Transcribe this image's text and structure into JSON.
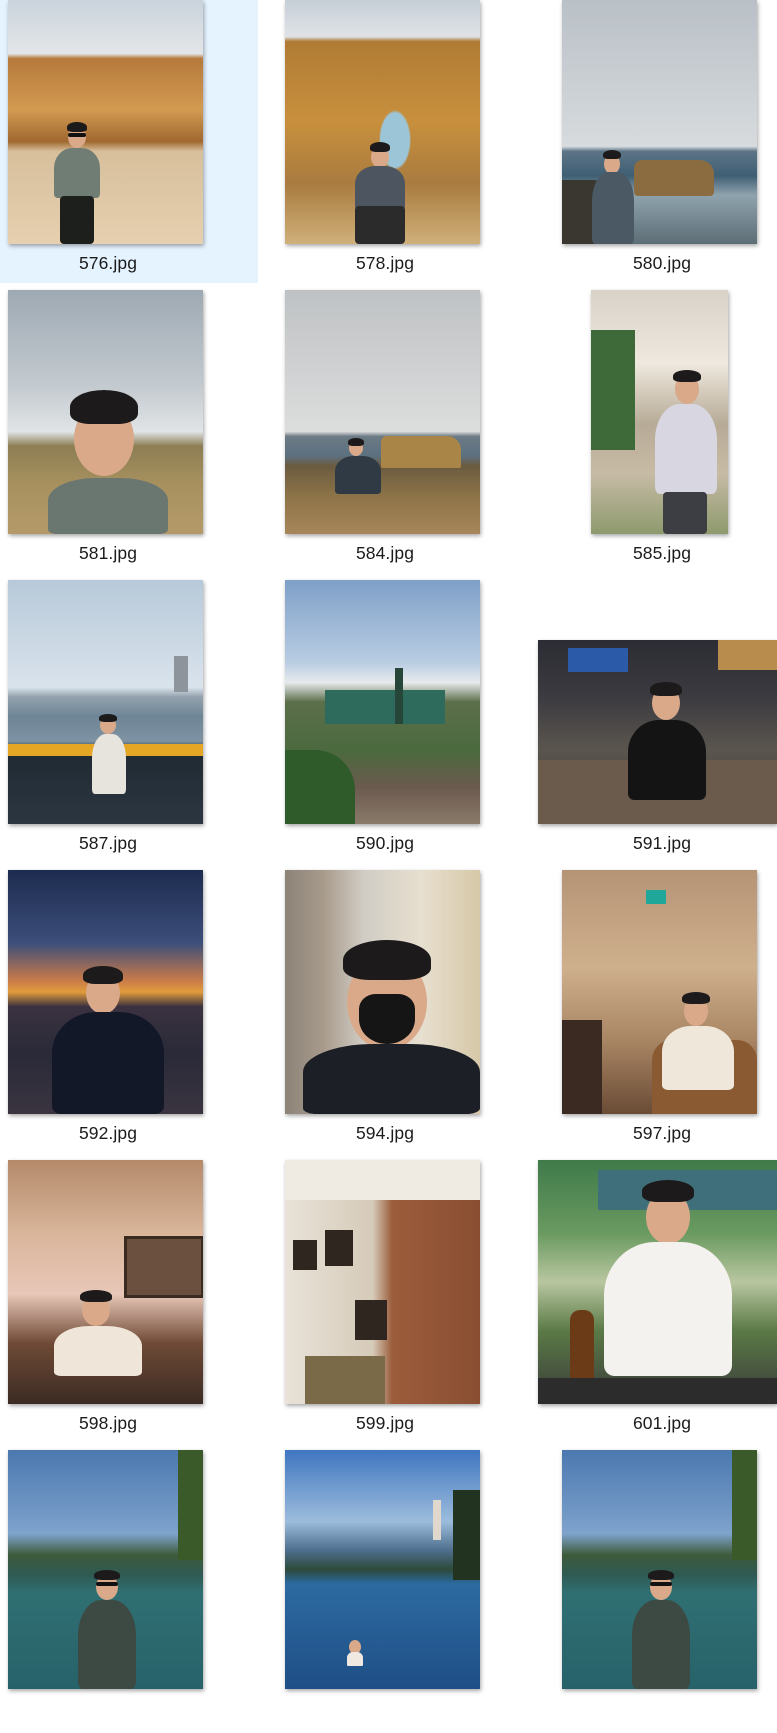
{
  "files": [
    {
      "name": "576.jpg",
      "selected": true,
      "scene": "coastal-cliff-beach"
    },
    {
      "name": "578.jpg",
      "selected": false,
      "scene": "rock-arch"
    },
    {
      "name": "580.jpg",
      "selected": false,
      "scene": "sea-rocks-cloudy"
    },
    {
      "name": "581.jpg",
      "selected": false,
      "scene": "selfie-cloudy-sky"
    },
    {
      "name": "584.jpg",
      "selected": false,
      "scene": "cliffside-sitting"
    },
    {
      "name": "585.jpg",
      "selected": false,
      "scene": "apartment-wall"
    },
    {
      "name": "587.jpg",
      "selected": false,
      "scene": "lake-net-city"
    },
    {
      "name": "590.jpg",
      "selected": false,
      "scene": "garden-cafe"
    },
    {
      "name": "591.jpg",
      "selected": false,
      "scene": "restaurant-lounge"
    },
    {
      "name": "592.jpg",
      "selected": false,
      "scene": "sunset-city-view"
    },
    {
      "name": "594.jpg",
      "selected": false,
      "scene": "face-mask-selfie"
    },
    {
      "name": "597.jpg",
      "selected": false,
      "scene": "wine-bar"
    },
    {
      "name": "598.jpg",
      "selected": false,
      "scene": "cave-restaurant"
    },
    {
      "name": "599.jpg",
      "selected": false,
      "scene": "brick-wall-cafe"
    },
    {
      "name": "601.jpg",
      "selected": false,
      "scene": "garden-table-beer"
    },
    {
      "name": "",
      "selected": false,
      "scene": "lake-bled-portrait"
    },
    {
      "name": "",
      "selected": false,
      "scene": "lake-swimming-church"
    },
    {
      "name": "",
      "selected": false,
      "scene": "lake-bled-portrait-2"
    }
  ],
  "colors": {
    "selection": "#e5f3ff",
    "label": "#1b1b1b",
    "background": "#ffffff"
  }
}
